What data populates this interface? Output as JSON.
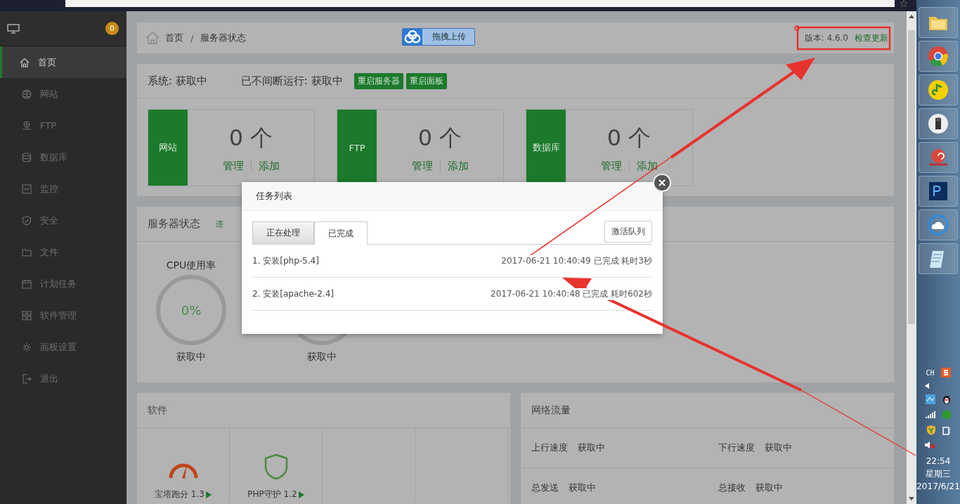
{
  "sidebar": {
    "badge": "0",
    "items": [
      {
        "label": "首页",
        "selected": true
      },
      {
        "label": "网站",
        "selected": false
      },
      {
        "label": "FTP",
        "selected": false
      },
      {
        "label": "数据库",
        "selected": false
      },
      {
        "label": "监控",
        "selected": false
      },
      {
        "label": "安全",
        "selected": false
      },
      {
        "label": "文件",
        "selected": false
      },
      {
        "label": "计划任务",
        "selected": false
      },
      {
        "label": "软件管理",
        "selected": false
      },
      {
        "label": "面板设置",
        "selected": false
      },
      {
        "label": "退出",
        "selected": false
      }
    ]
  },
  "breadcrumb": {
    "items": [
      "首页",
      "服务器状态"
    ],
    "separator": "/"
  },
  "upload_button": "拖拽上传",
  "version": "版本: 4.6.0",
  "update_link": "检查更新",
  "system": {
    "os": "系统: 获取中",
    "uptime": "已不间断运行: 获取中",
    "buttons": [
      "重启服务器",
      "重启面板"
    ]
  },
  "stats": [
    {
      "label": "网站",
      "count": "0 个",
      "links": [
        "管理",
        "添加"
      ]
    },
    {
      "label": "FTP",
      "count": "0 个",
      "links": [
        "管理",
        "添加"
      ]
    },
    {
      "label": "数据库",
      "count": "0 个",
      "links": [
        "管理",
        "添加"
      ]
    }
  ],
  "server_status": {
    "title": "服务器状态",
    "link": "连",
    "gauges": [
      {
        "title": "CPU使用率",
        "value": "0%",
        "caption": "获取中"
      },
      {
        "caption": "获取中"
      }
    ]
  },
  "software": {
    "title": "软件",
    "items": [
      {
        "name": "宝塔跑分 1.3"
      },
      {
        "name": "PHP守护 1.2"
      }
    ]
  },
  "network": {
    "title": "网络流量",
    "stats": [
      {
        "label": "上行速度",
        "value": "获取中"
      },
      {
        "label": "下行速度",
        "value": "获取中"
      },
      {
        "label": "总发送",
        "value": "获取中"
      },
      {
        "label": "总接收",
        "value": "获取中"
      }
    ]
  },
  "modal": {
    "title": "任务列表",
    "tabs": [
      {
        "label": "正在处理",
        "selected": false
      },
      {
        "label": "已完成",
        "selected": true
      }
    ],
    "action": "激活队列",
    "tasks": [
      {
        "name": "1. 安装[php-5.4]",
        "detail": "2017-06-21 10:40:49 已完成 耗时3秒"
      },
      {
        "name": "2. 安装[apache-2.4]",
        "detail": "2017-06-21 10:40:48 已完成 耗时602秒"
      }
    ]
  },
  "taskbar": {
    "ime": "CH",
    "time": "22:54",
    "weekday": "星期三",
    "date": "2017/6/21"
  }
}
